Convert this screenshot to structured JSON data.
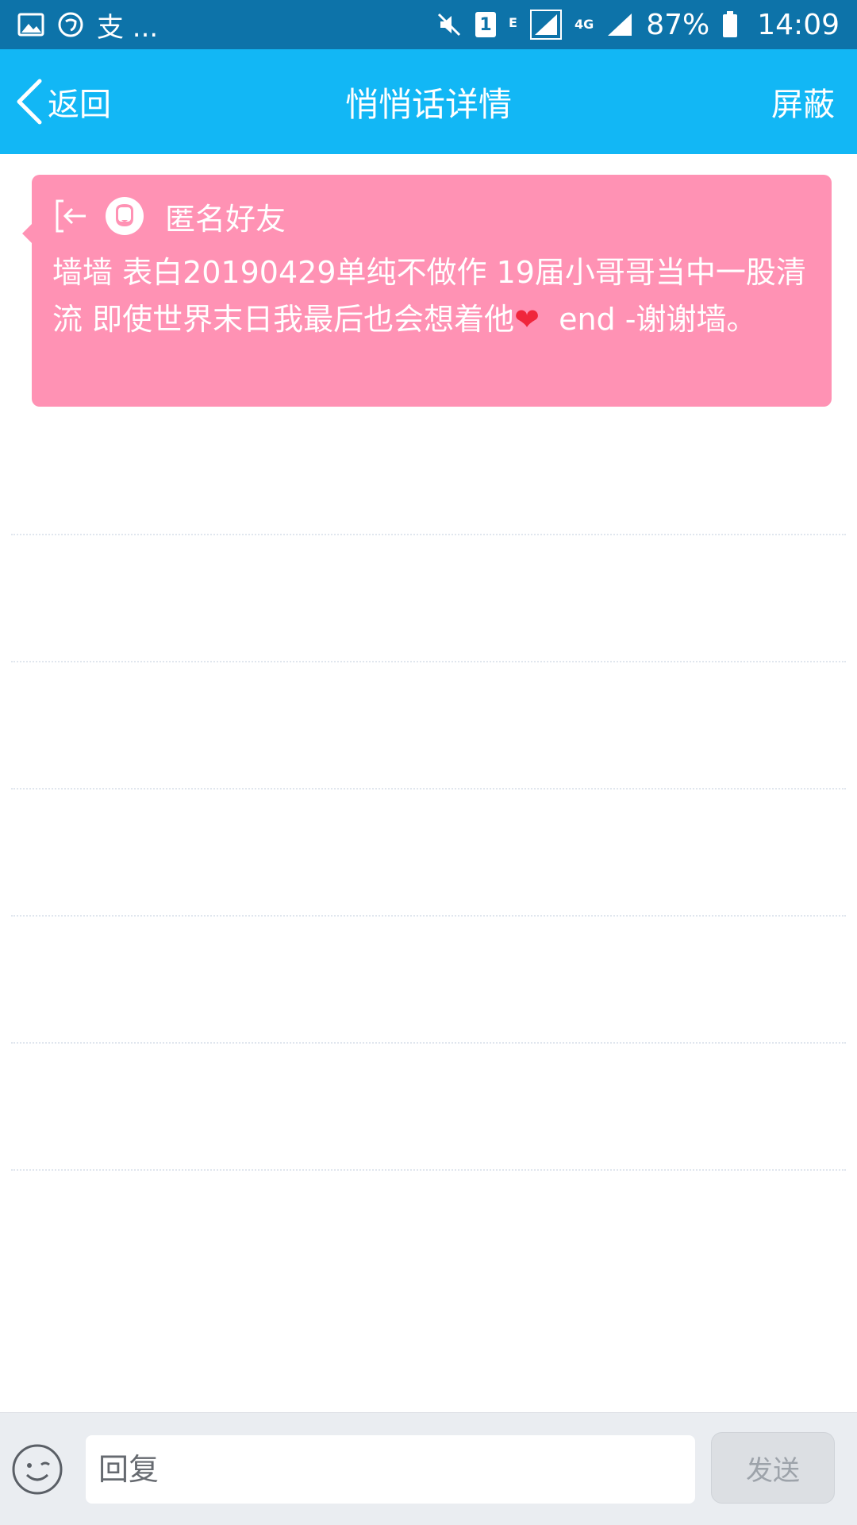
{
  "status_bar": {
    "notification_text": "支 ...",
    "sim_label": "1",
    "network_label_e": "E",
    "network_label_4g": "4G",
    "battery_percent": "87%",
    "time": "14:09"
  },
  "header": {
    "back_label": "返回",
    "title": "悄悄话详情",
    "block_label": "屏蔽"
  },
  "message": {
    "sender": "匿名好友",
    "text_before_heart": "墙墙 表白20190429单纯不做作 19届小哥哥当中一股清流 即使世界末日我最后也会想着他",
    "heart": "❤",
    "text_after_heart": "  end -谢谢墙。"
  },
  "composer": {
    "placeholder": "回复",
    "send_label": "发送"
  },
  "colors": {
    "status_bar": "#0d73a9",
    "title_bar": "#12b7f5",
    "card": "#ff92b4"
  }
}
